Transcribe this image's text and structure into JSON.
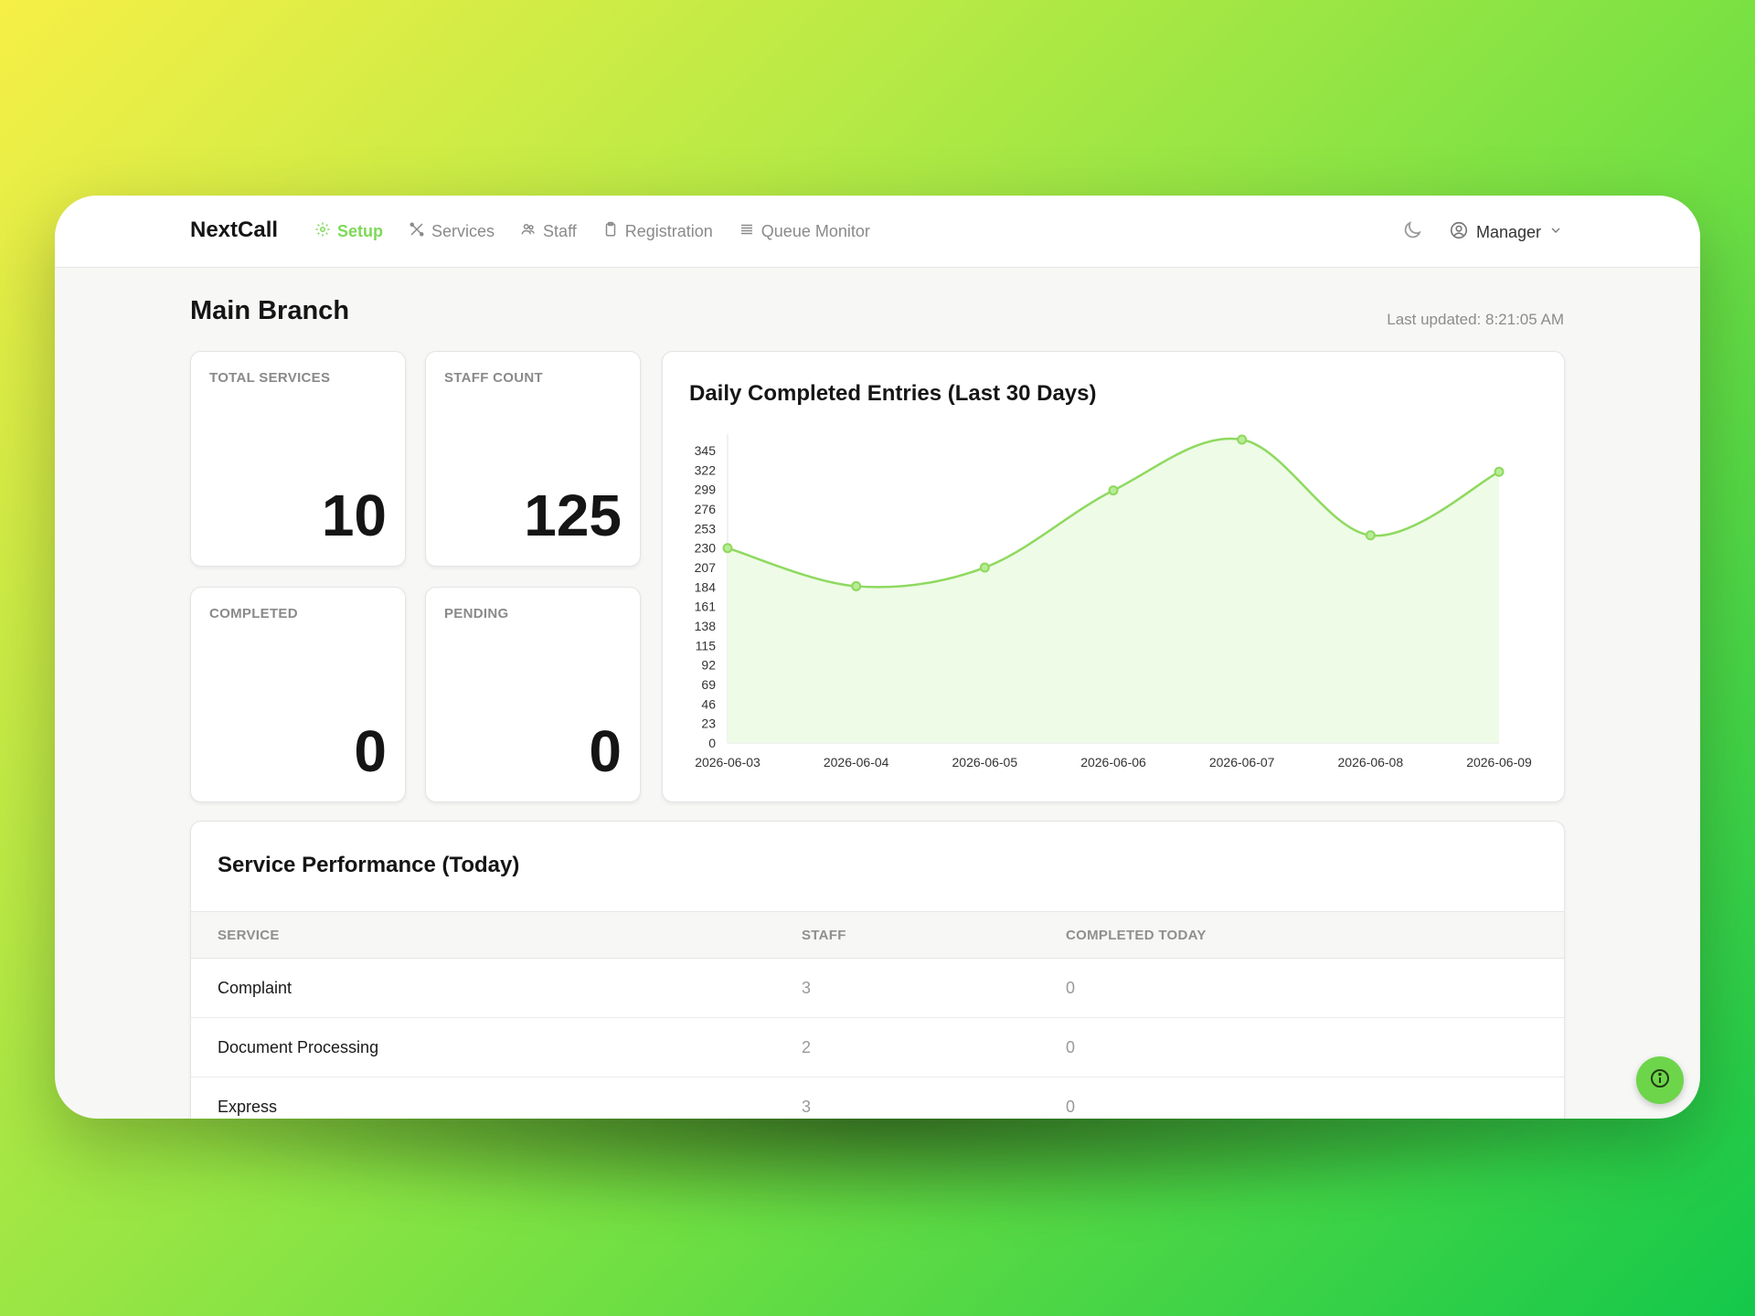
{
  "app": {
    "name": "NextCall"
  },
  "nav": {
    "items": [
      {
        "label": "Setup",
        "icon": "gear-icon",
        "active": true
      },
      {
        "label": "Services",
        "icon": "tools-icon",
        "active": false
      },
      {
        "label": "Staff",
        "icon": "users-icon",
        "active": false
      },
      {
        "label": "Registration",
        "icon": "clipboard-icon",
        "active": false
      },
      {
        "label": "Queue Monitor",
        "icon": "list-icon",
        "active": false
      }
    ],
    "theme_icon": "moon-icon",
    "user": {
      "label": "Manager",
      "icon": "user-circle-icon"
    }
  },
  "page": {
    "title": "Main Branch",
    "last_updated": "Last updated: 8:21:05 AM"
  },
  "stats": [
    {
      "label": "TOTAL SERVICES",
      "value": "10"
    },
    {
      "label": "STAFF COUNT",
      "value": "125"
    },
    {
      "label": "COMPLETED",
      "value": "0"
    },
    {
      "label": "PENDING",
      "value": "0"
    }
  ],
  "chart_data": {
    "type": "area",
    "title": "Daily Completed Entries (Last 30 Days)",
    "x": [
      "2026-06-03",
      "2026-06-04",
      "2026-06-05",
      "2026-06-06",
      "2026-06-07",
      "2026-06-08",
      "2026-06-09"
    ],
    "values": [
      230,
      185,
      207,
      298,
      358,
      245,
      320
    ],
    "yticks": [
      "0",
      "23",
      "46",
      "69",
      "92",
      "115",
      "138",
      "161",
      "184",
      "207",
      "230",
      "253",
      "276",
      "299",
      "322",
      "345"
    ],
    "ylim": [
      0,
      358
    ],
    "grid": false,
    "legend": "none",
    "color": "#8ed95f"
  },
  "performance": {
    "title": "Service Performance (Today)",
    "columns": [
      "SERVICE",
      "STAFF",
      "COMPLETED TODAY"
    ],
    "rows": [
      {
        "service": "Complaint",
        "staff": "3",
        "completed": "0"
      },
      {
        "service": "Document Processing",
        "staff": "2",
        "completed": "0"
      },
      {
        "service": "Express",
        "staff": "3",
        "completed": "0"
      }
    ]
  },
  "fab": {
    "icon": "info-icon"
  }
}
